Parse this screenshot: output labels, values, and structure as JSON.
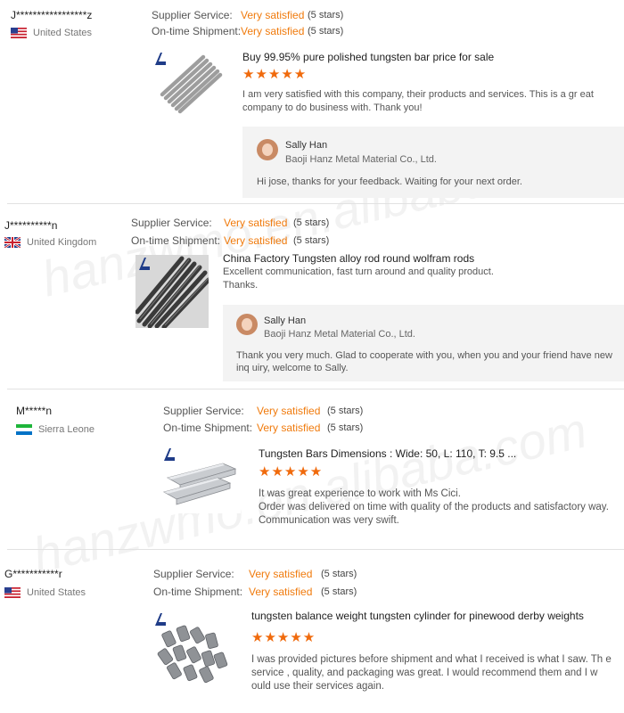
{
  "watermark": "hanzwmo.en.alibaba.com",
  "colors": {
    "accent": "#f07a0c",
    "star": "#f06a0c"
  },
  "stars_glyph": "★★★★★",
  "reviews": [
    {
      "buyer": "J*****************z",
      "country": "United States",
      "flag": "us-flag-icon",
      "service_label": "Supplier Service:",
      "service_value": "Very satisfied",
      "service_stars": "(5 stars)",
      "shipment_label": "On-time Shipment:",
      "shipment_value": "Very satisfied",
      "shipment_stars": "(5 stars)",
      "product": "Buy 99.95% pure polished tungsten bar price for sale",
      "rating": 5,
      "comment": "I am very satisfied with this company, their products and services. This is a gr eat company to do business with. Thank you!",
      "reply": {
        "name": "Sally Han",
        "company": "Baoji Hanz Metal Material Co., Ltd.",
        "text": "Hi jose, thanks for your feedback. Waiting for your next order."
      }
    },
    {
      "buyer": "J**********n",
      "country": "United Kingdom",
      "flag": "uk-flag-icon",
      "service_label": "Supplier Service:",
      "service_value": "Very satisfied",
      "service_stars": "(5 stars)",
      "shipment_label": "On-time Shipment:",
      "shipment_value": "Very satisfied",
      "shipment_stars": "(5 stars)",
      "product": "China Factory Tungsten alloy rod round wolfram rods",
      "comment_lines": [
        "Excellent communication, fast turn around and quality product.",
        "Thanks."
      ],
      "reply": {
        "name": "Sally Han",
        "company": "Baoji Hanz Metal Material Co., Ltd.",
        "text": "Thank you very much. Glad to cooperate with you, when you and your friend have new inq uiry, welcome to Sally."
      }
    },
    {
      "buyer": "M*****n",
      "country": "Sierra Leone",
      "flag": "sierra-leone-flag-icon",
      "service_label": "Supplier Service:",
      "service_value": "Very satisfied",
      "service_stars": "(5 stars)",
      "shipment_label": "On-time Shipment:",
      "shipment_value": "Very satisfied",
      "shipment_stars": "(5 stars)",
      "product": "Tungsten Bars Dimensions : Wide: 50, L: 110, T: 9.5 ...",
      "rating": 5,
      "comment_lines": [
        "It was great experience to work with Ms Cici.",
        "Order was delivered on time with quality of the products and satisfactory way.",
        "Communication was very swift."
      ]
    },
    {
      "buyer": "G***********r",
      "country": "United States",
      "flag": "us-flag-icon",
      "service_label": "Supplier Service:",
      "service_value": "Very satisfied",
      "service_stars": "(5 stars)",
      "shipment_label": "On-time Shipment:",
      "shipment_value": "Very satisfied",
      "shipment_stars": "(5 stars)",
      "product": "tungsten balance weight tungsten cylinder for pinewood derby weights",
      "rating": 5,
      "comment": "I was provided pictures before shipment and what I received is what I saw. Th e service , quality, and packaging was great. I would recommend them and I w ould use their services again."
    }
  ]
}
